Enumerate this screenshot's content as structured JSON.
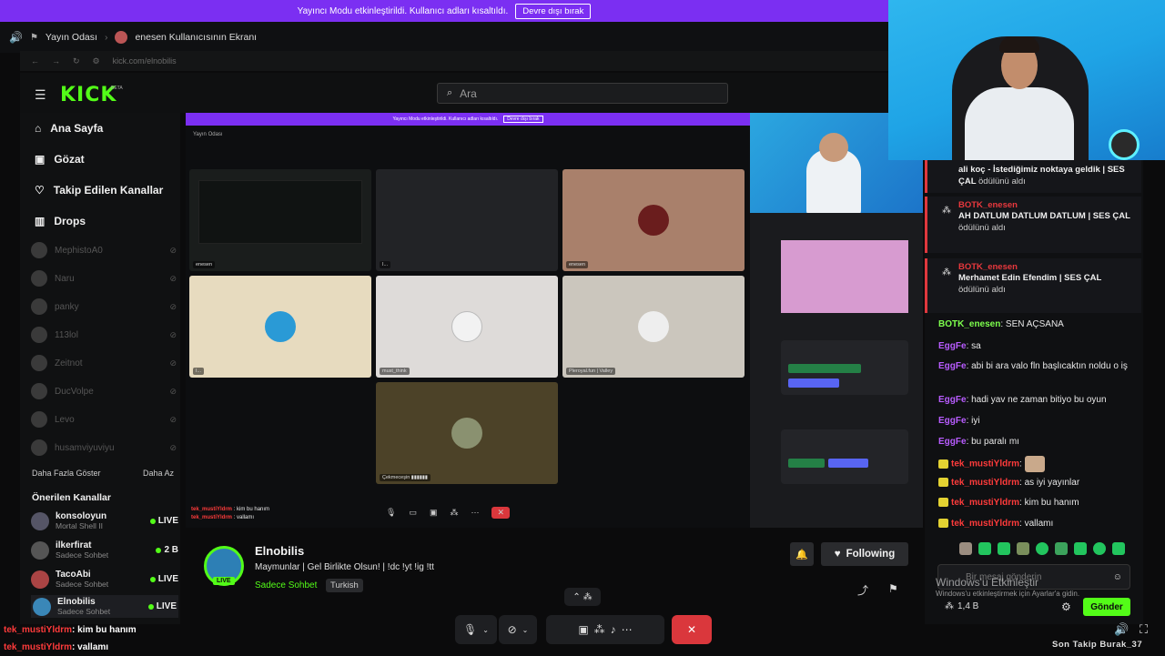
{
  "banner": {
    "text": "Yayıncı Modu etkinleştirildi. Kullanıcı adları kısaltıldı.",
    "button": "Devre dışı bırak"
  },
  "share_header": {
    "room": "Yayın Odası",
    "screen": "enesen Kullanıcısının Ekranı"
  },
  "browser": {
    "url": "kick.com/elnobilis"
  },
  "kick": {
    "logo": "KICK",
    "beta": "BETA",
    "search_placeholder": "Ara",
    "nav": [
      "Ana Sayfa",
      "Gözat",
      "Takip Edilen Kanallar",
      "Drops"
    ],
    "followed": [
      "MephistoA0",
      "Naru",
      "panky",
      "113lol",
      "Zeitnot",
      "DucVolpe",
      "Levo",
      "husamviyuviyu"
    ],
    "show_more": "Daha Fazla Göster",
    "show_less": "Daha Az",
    "recommended_title": "Önerilen Kanallar",
    "recommended": [
      {
        "name": "konsoloyun",
        "sub": "Mortal Shell II",
        "status": "LIVE"
      },
      {
        "name": "ilkerfirat",
        "sub": "Sadece Sohbet",
        "status": "2 B"
      },
      {
        "name": "TacoAbi",
        "sub": "Sadece Sohbet",
        "status": "LIVE"
      },
      {
        "name": "Elnobilis",
        "sub": "Sadece Sohbet",
        "status": "LIVE"
      }
    ]
  },
  "video": {
    "inner_banner": "Yayıncı Modu etkinleştirildi. Kullanıcı adları kısaltıldı.",
    "inner_banner_button": "Devre dışı bırak",
    "inner_room": "Yayın Odası",
    "tiles": [
      "enesen",
      "I...",
      "enesen",
      "I...",
      "must_think",
      "Pleroyal.fun | Valley",
      "Çekmeceşin ▮▮▮▮▮▮"
    ],
    "bottom_chat": [
      {
        "user": "tek_mustiYldrm",
        "text": "kim bu hanım"
      },
      {
        "user": "tek_mustiYldrm",
        "text": "vallamı"
      }
    ]
  },
  "channel": {
    "name": "Elnobilis",
    "title": "Maymunlar | Gel Birlikte Olsun! | !dc !yt !ig !tt",
    "category": "Sadece Sohbet",
    "language": "Turkish",
    "live_badge": "LIVE",
    "following_label": "Following"
  },
  "chat": {
    "rewards": [
      {
        "user": "ali koç",
        "text": "İstediğimiz noktaya geldik | SES ÇAL",
        "suffix": "ödülünü aldı"
      },
      {
        "user": "BOTK_enesen",
        "text": "AH DATLUM DATLUM DATLUM | SES ÇAL",
        "suffix": "ödülünü aldı"
      },
      {
        "user": "BOTK_enesen",
        "text": "Merhamet Edin Efendim | SES ÇAL",
        "suffix": "ödülünü aldı"
      }
    ],
    "messages": [
      {
        "user": "BOTK_enesen",
        "text": "SEN AÇSANA",
        "color": "green"
      },
      {
        "user": "EggFe",
        "text": "sa",
        "color": "purple"
      },
      {
        "user": "EggFe",
        "text": "abi bi ara valo fln başlıcaktın noldu o iş",
        "color": "purple"
      },
      {
        "user": "EggFe",
        "text": "hadi yav ne zaman bitiyo bu oyun",
        "color": "purple"
      },
      {
        "user": "EggFe",
        "text": "iyi",
        "color": "purple"
      },
      {
        "user": "EggFe",
        "text": "bu paralı mı",
        "color": "purple"
      },
      {
        "user": "tek_mustiYldrm",
        "text": "",
        "color": "red"
      },
      {
        "user": "tek_mustiYldrm",
        "text": "as iyi yayınlar",
        "color": "red"
      },
      {
        "user": "tek_mustiYldrm",
        "text": "kim bu hanım",
        "color": "red"
      },
      {
        "user": "tek_mustiYldrm",
        "text": "vallamı",
        "color": "red"
      }
    ],
    "input_placeholder": "Bir mesaj gönderin",
    "viewer_count": "1,4 B",
    "send_label": "Gönder",
    "watermark_title": "Windows'u Etkinleştir",
    "watermark_sub": "Windows'u etkinleştirmek için Ayarlar'a gidin."
  },
  "overlay_chat": [
    {
      "user": "tek_mustiYldrm",
      "text": ": kim bu hanım"
    },
    {
      "user": "tek_mustiYldrm",
      "text": ": vallamı"
    }
  ],
  "ticker": "Son Takip Burak_37",
  "colors": {
    "kick_green": "#53fc18",
    "streamer_banner": "#7b2ff2",
    "reward_red": "#e8383d",
    "end_call": "#da373c"
  }
}
